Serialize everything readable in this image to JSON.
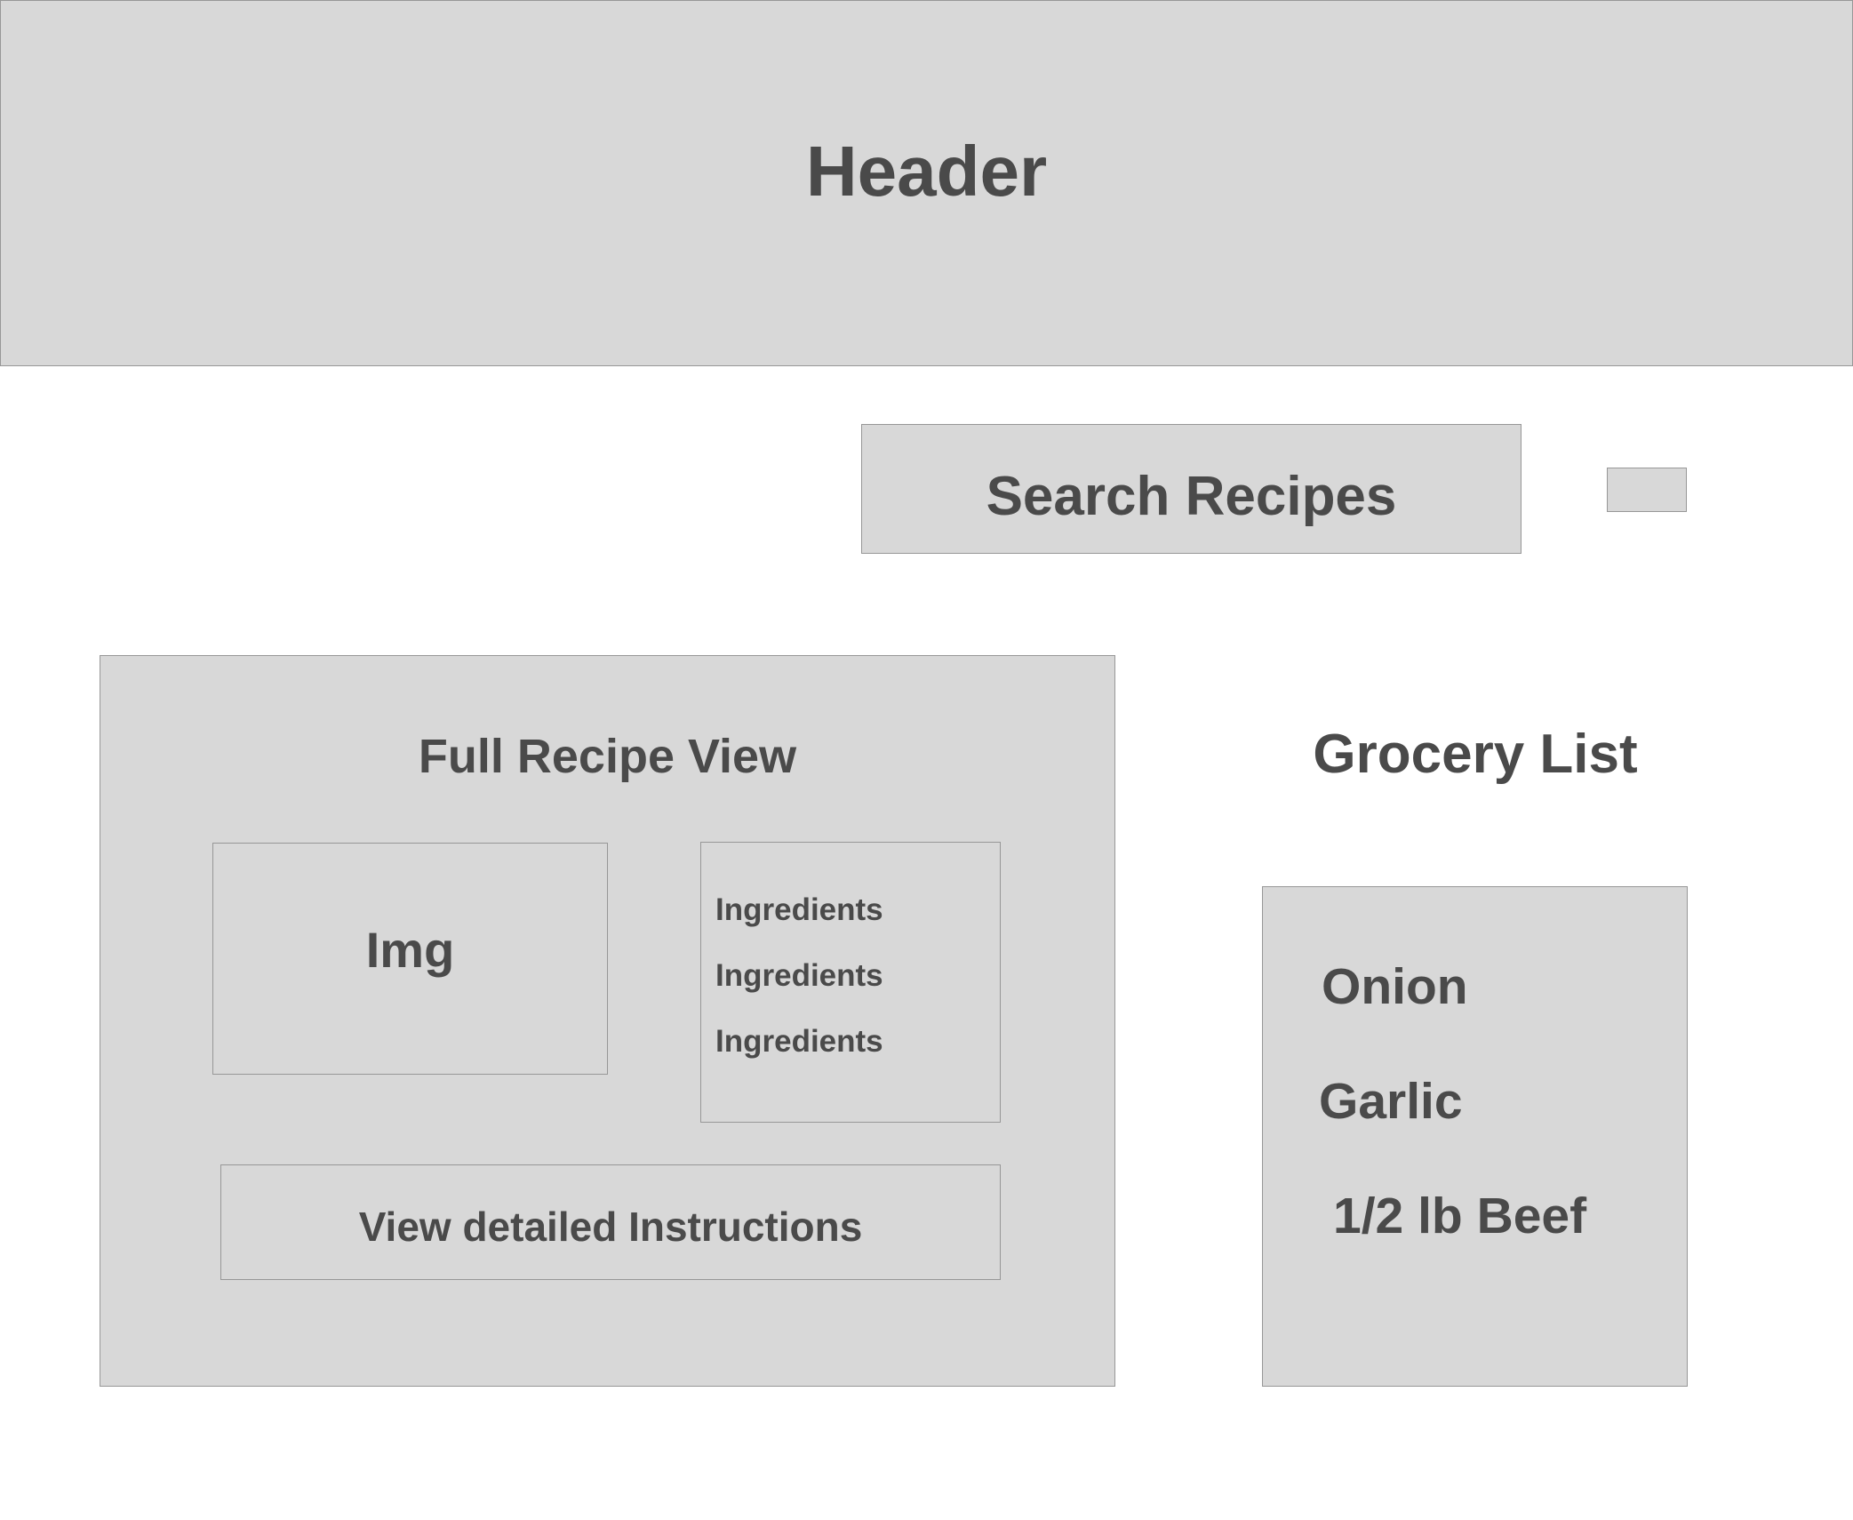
{
  "header": {
    "title": "Header"
  },
  "search": {
    "label": "Search Recipes"
  },
  "recipe": {
    "title": "Full Recipe View",
    "image_label": "Img",
    "ingredients": [
      "Ingredients",
      "Ingredients",
      "Ingredients"
    ],
    "instructions_label": "View detailed Instructions"
  },
  "grocery": {
    "title": "Grocery List",
    "items": [
      "Onion",
      "Garlic",
      "1/2 lb Beef"
    ]
  },
  "colors": {
    "box_fill": "#d8d8d8",
    "box_border": "#979797",
    "text": "#4a4a4a",
    "background": "#ffffff"
  }
}
